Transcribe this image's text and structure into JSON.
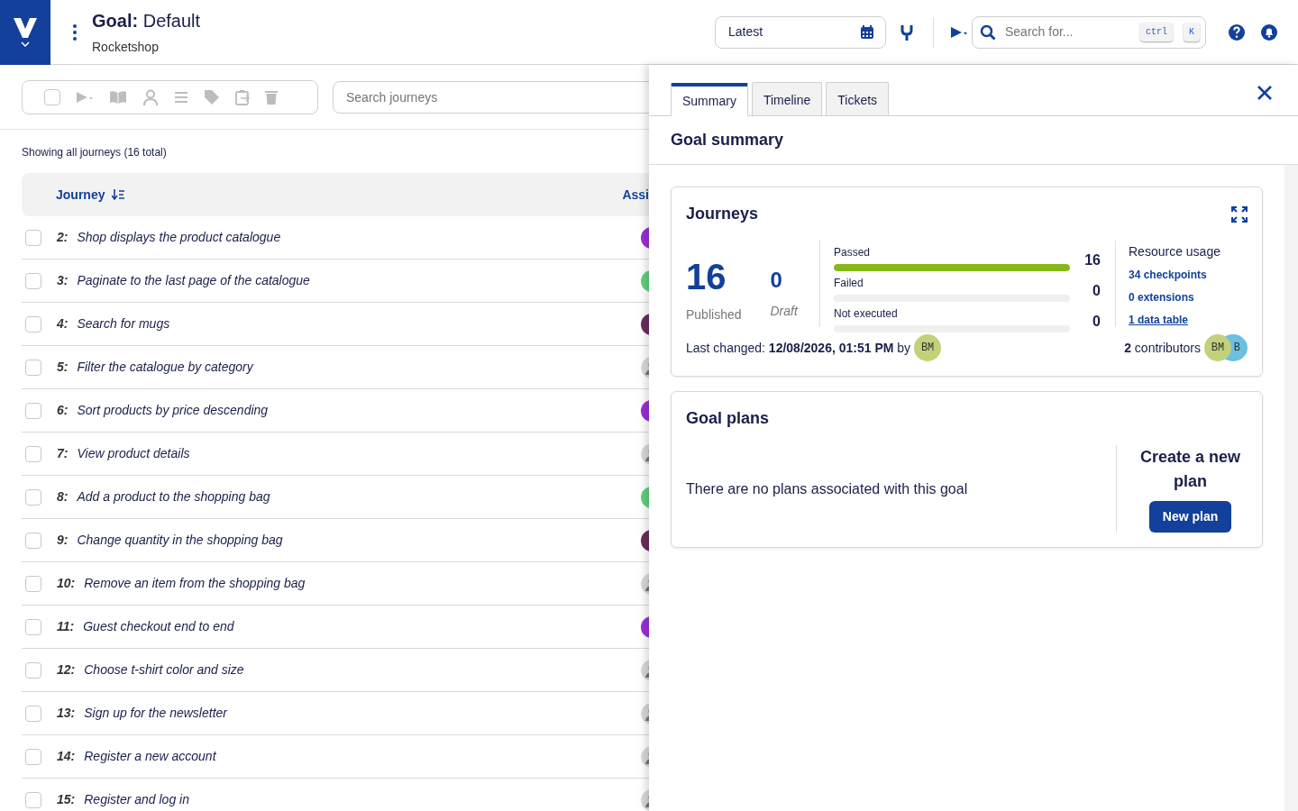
{
  "header": {
    "title_label": "Goal:",
    "title_value": "Default",
    "subtitle": "Rocketshop",
    "version_field": {
      "value": "Latest"
    },
    "search": {
      "placeholder": "Search for...",
      "keys": [
        "ctrl",
        "K"
      ]
    }
  },
  "toolbar": {
    "select_all_checked": false,
    "search": {
      "placeholder": "Search journeys"
    }
  },
  "list": {
    "summary": "Showing all journeys (16 total)",
    "columns": [
      "Journey",
      "Assi"
    ],
    "rows": [
      {
        "number": "2:",
        "name": "Shop displays the product catalogue",
        "checked": false,
        "assignee": {
          "kind": "initials",
          "color": "#9b30d9"
        }
      },
      {
        "number": "3:",
        "name": "Paginate to the last page of the catalogue",
        "checked": false,
        "assignee": {
          "kind": "initials",
          "color": "#62d07e"
        }
      },
      {
        "number": "4:",
        "name": "Search for mugs",
        "checked": false,
        "assignee": {
          "kind": "initials",
          "color": "#6b2d5c"
        }
      },
      {
        "number": "5:",
        "name": "Filter the catalogue by category",
        "checked": false,
        "assignee": {
          "kind": "placeholder"
        }
      },
      {
        "number": "6:",
        "name": "Sort products by price descending",
        "checked": false,
        "assignee": {
          "kind": "initials",
          "color": "#9b30d9"
        }
      },
      {
        "number": "7:",
        "name": "View product details",
        "checked": false,
        "assignee": {
          "kind": "placeholder"
        }
      },
      {
        "number": "8:",
        "name": "Add a product to the shopping bag",
        "checked": false,
        "assignee": {
          "kind": "initials",
          "color": "#62d07e"
        }
      },
      {
        "number": "9:",
        "name": "Change quantity in the shopping bag",
        "checked": false,
        "assignee": {
          "kind": "initials",
          "color": "#6b2d5c"
        }
      },
      {
        "number": "10:",
        "name": "Remove an item from the shopping bag",
        "checked": false,
        "assignee": {
          "kind": "placeholder"
        }
      },
      {
        "number": "11:",
        "name": "Guest checkout end to end",
        "checked": false,
        "assignee": {
          "kind": "initials",
          "color": "#9b30d9"
        }
      },
      {
        "number": "12:",
        "name": "Choose t-shirt color and size",
        "checked": false,
        "assignee": {
          "kind": "placeholder"
        }
      },
      {
        "number": "13:",
        "name": "Sign up for the newsletter",
        "checked": false,
        "assignee": {
          "kind": "placeholder"
        }
      },
      {
        "number": "14:",
        "name": "Register a new account",
        "checked": false,
        "assignee": {
          "kind": "placeholder"
        }
      },
      {
        "number": "15:",
        "name": "Register and log in",
        "checked": false,
        "assignee": {
          "kind": "placeholder"
        }
      }
    ]
  },
  "panel": {
    "tabs": [
      {
        "label": "Summary",
        "selected": true
      },
      {
        "label": "Timeline",
        "selected": false
      },
      {
        "label": "Tickets",
        "selected": false
      }
    ],
    "heading": "Goal summary",
    "journeys_card": {
      "title": "Journeys",
      "published_count": "16",
      "published_label": "Published",
      "draft_count": "0",
      "draft_label": "Draft",
      "results": [
        {
          "label": "Passed",
          "count": "16",
          "level": 1.0
        },
        {
          "label": "Failed",
          "count": "0",
          "level": 0
        },
        {
          "label": "Not executed",
          "count": "0",
          "level": 0
        }
      ],
      "resources_title": "Resource usage",
      "resources": [
        {
          "text": "34 checkpoints",
          "underlined": false
        },
        {
          "text": "0 extensions",
          "underlined": false
        },
        {
          "text": "1 data table",
          "underlined": true
        }
      ],
      "last_changed": "Last changed: **12/08/2026, 01:51 PM** by",
      "last_changed_avatar": "BM",
      "contributors": "**2** contributors",
      "contributor_avatars": [
        {
          "initials": "BM",
          "color": "#c3d17a"
        },
        {
          "initials": "B",
          "color": "#6bbfe0"
        }
      ]
    },
    "plans_card": {
      "title": "Goal plans",
      "empty_text": "There are no plans associated with this goal",
      "create_heading": "Create a new plan",
      "button": "New plan"
    }
  }
}
